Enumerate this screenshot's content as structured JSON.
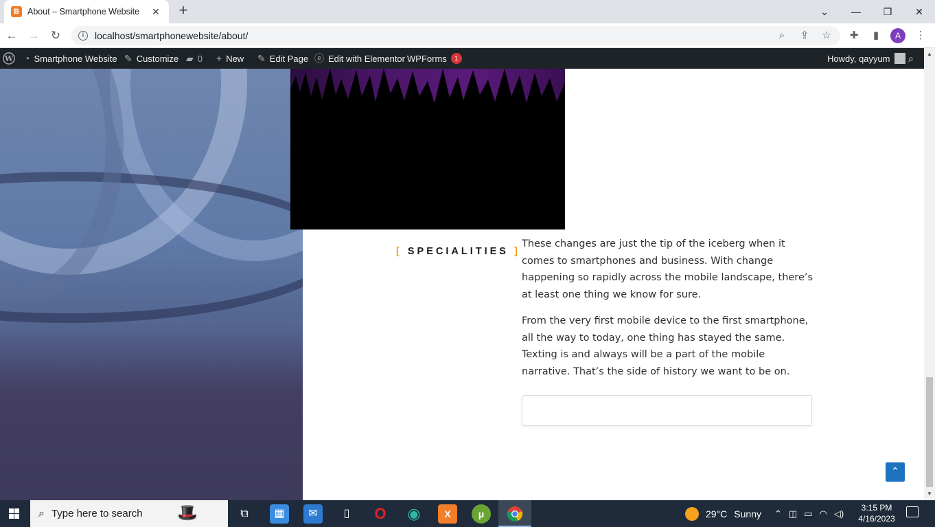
{
  "browser": {
    "tab_title": "About – Smartphone Website",
    "tab_favicon": "B",
    "tab_close": "✕",
    "new_tab": "+",
    "window_controls": {
      "collapse": "⌄",
      "minimize": "—",
      "restore": "❐",
      "close": "✕"
    },
    "url": "localhost/smartphonewebsite/about/",
    "profile_initial": "A"
  },
  "adminbar": {
    "site_name": "Smartphone Website",
    "customize": "Customize",
    "comments_count": "0",
    "new_label": "New",
    "edit_page": "Edit Page",
    "edit_elementor": "Edit with Elementor",
    "wpforms": "WPForms",
    "wpforms_badge": "1",
    "howdy": "Howdy, qayyum"
  },
  "content": {
    "spec_open": "[",
    "spec_text": "SPECIALITIES",
    "spec_close": "]",
    "para1": "These changes are just the tip of the iceberg when it comes to smartphones and business. With change happening so rapidly across the mobile landscape, there’s at least one thing we know for sure.",
    "para2": "From the very first mobile device to the first smartphone, all the way to today, one thing has stayed the same. Texting is and always will be a part of the mobile narrative. That’s the side of history we want to be on.",
    "back_to_top_icon": "chevron-up"
  },
  "taskbar": {
    "search_placeholder": "Type here to search",
    "weather_temp": "29°C",
    "weather_text": "Sunny",
    "time": "3:15 PM",
    "date": "4/16/2023"
  },
  "colors": {
    "accent_bracket": "#f2a31a",
    "adminbar_bg": "#1d2327",
    "back_to_top": "#1e73be",
    "wpforms_badge": "#d63638"
  }
}
